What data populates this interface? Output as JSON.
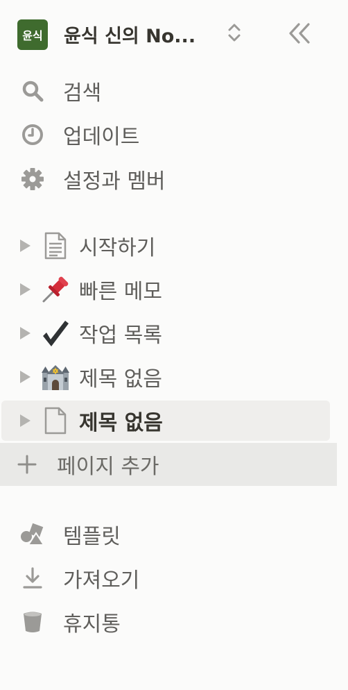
{
  "workspace": {
    "avatar_text": "윤식",
    "name": "윤식 신의 No...",
    "avatar_color": "#3f6b2e"
  },
  "top_nav": [
    {
      "label": "검색",
      "icon": "search-icon"
    },
    {
      "label": "업데이트",
      "icon": "clock-icon"
    },
    {
      "label": "설정과 멤버",
      "icon": "gear-icon"
    }
  ],
  "pages": [
    {
      "label": "시작하기",
      "icon": "document-lines-icon",
      "selected": false
    },
    {
      "label": "빠른 메모",
      "icon": "pushpin-icon",
      "selected": false
    },
    {
      "label": "작업 목록",
      "icon": "check-mark-icon",
      "selected": false
    },
    {
      "label": "제목 없음",
      "icon": "synagogue-icon",
      "selected": false
    },
    {
      "label": "제목 없음",
      "icon": "blank-page-icon",
      "selected": true
    }
  ],
  "add_page": {
    "label": "페이지 추가",
    "icon": "plus-icon"
  },
  "bottom_nav": [
    {
      "label": "템플릿",
      "icon": "shapes-icon"
    },
    {
      "label": "가져오기",
      "icon": "download-icon"
    },
    {
      "label": "휴지통",
      "icon": "trash-icon"
    }
  ],
  "colors": {
    "sidebar_bg": "#fbfbfa",
    "selected_bg": "#efeeec",
    "hover_bg": "#e9e9e7",
    "text": "#37352f",
    "muted_text": "#5f5e5b",
    "icon_gray": "#9b9a97"
  }
}
